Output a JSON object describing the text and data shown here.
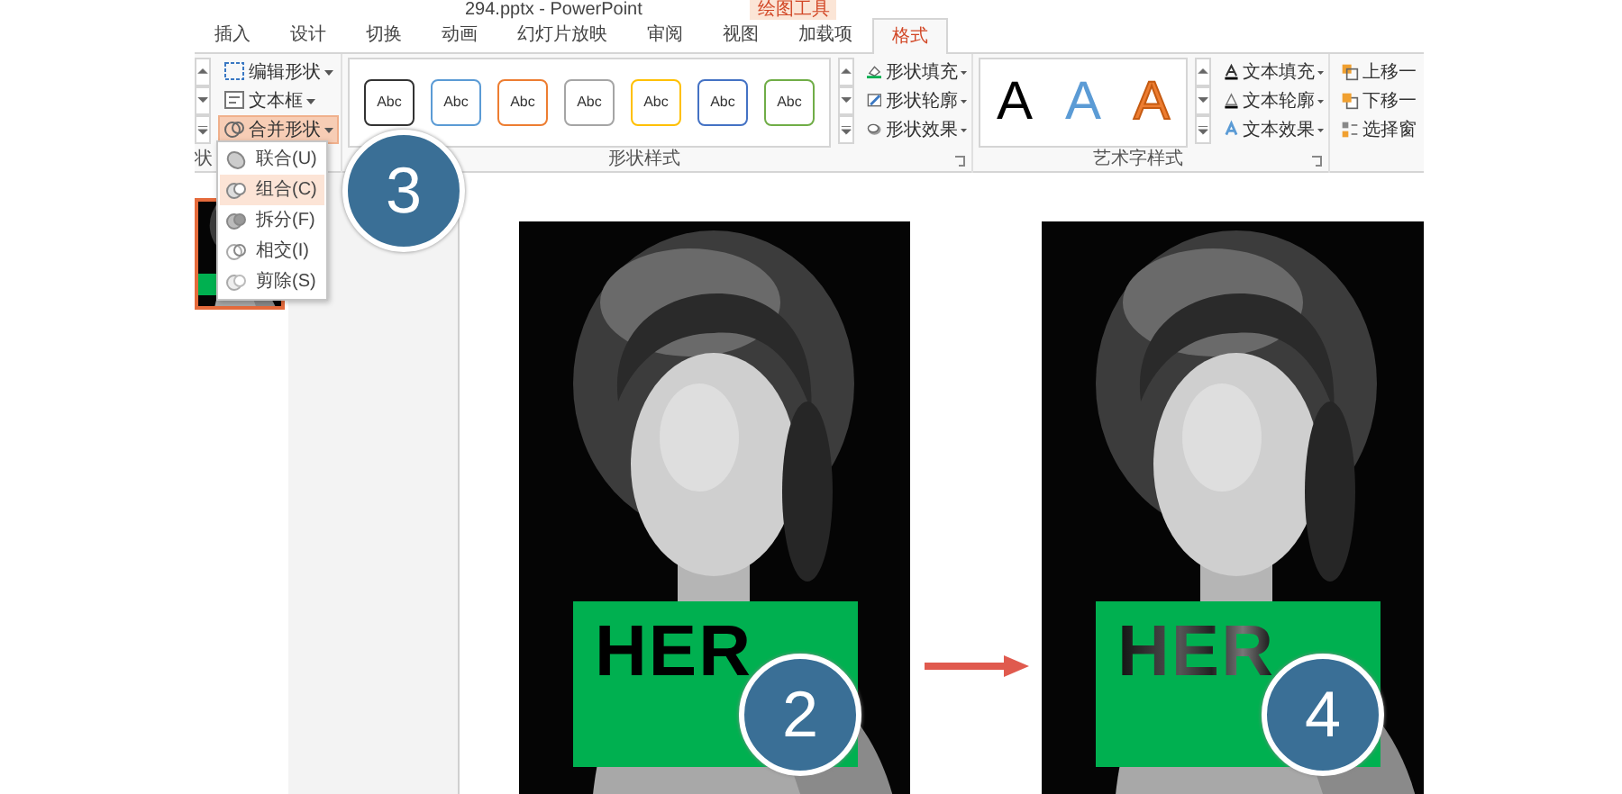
{
  "title_bar": {
    "document_title": "294.pptx - PowerPoint",
    "context_label": "绘图工具"
  },
  "tabs": [
    {
      "label": "插入",
      "selected": false
    },
    {
      "label": "设计",
      "selected": false
    },
    {
      "label": "切换",
      "selected": false
    },
    {
      "label": "动画",
      "selected": false
    },
    {
      "label": "幻灯片放映",
      "selected": false
    },
    {
      "label": "审阅",
      "selected": false
    },
    {
      "label": "视图",
      "selected": false
    },
    {
      "label": "加载项",
      "selected": false
    },
    {
      "label": "格式",
      "selected": true
    }
  ],
  "insert_shapes": {
    "label": "状",
    "commands": [
      {
        "label": "编辑形状",
        "selected": false
      },
      {
        "label": "文本框",
        "selected": false
      },
      {
        "label": "合并形状",
        "selected": true
      }
    ]
  },
  "shape_styles": {
    "label": "形状样式",
    "presets": [
      {
        "label": "Abc",
        "color": "#333333"
      },
      {
        "label": "Abc",
        "color": "#5b9bd5"
      },
      {
        "label": "Abc",
        "color": "#ed7d31"
      },
      {
        "label": "Abc",
        "color": "#a5a5a5"
      },
      {
        "label": "Abc",
        "color": "#ffc000"
      },
      {
        "label": "Abc",
        "color": "#4472c4"
      },
      {
        "label": "Abc",
        "color": "#70ad47"
      }
    ],
    "commands": [
      "形状填充",
      "形状轮廓",
      "形状效果"
    ]
  },
  "wordart_styles": {
    "label": "艺术字样式",
    "presets": [
      {
        "label": "A",
        "kind": "filled",
        "color": "#000000"
      },
      {
        "label": "A",
        "kind": "filled",
        "color": "#5b9bd5"
      },
      {
        "label": "A",
        "kind": "outline",
        "color": "#ed7d31"
      }
    ],
    "commands": [
      "文本填充",
      "文本轮廓",
      "文本效果"
    ]
  },
  "arrange": {
    "commands": [
      "上移一",
      "下移一",
      "选择窗"
    ]
  },
  "merge_menu": {
    "items": [
      {
        "label": "联合(U)",
        "selected": false
      },
      {
        "label": "组合(C)",
        "selected": true
      },
      {
        "label": "拆分(F)",
        "selected": false
      },
      {
        "label": "相交(I)",
        "selected": false
      },
      {
        "label": "剪除(S)",
        "selected": false
      }
    ]
  },
  "thumbnails": [
    {
      "selected": true
    }
  ],
  "step_badge": "3",
  "slide": {
    "panels": [
      {
        "caption": "HER",
        "number": "2",
        "kind": "solid"
      },
      {
        "caption": "HER",
        "number": "4",
        "kind": "knockout"
      }
    ]
  }
}
